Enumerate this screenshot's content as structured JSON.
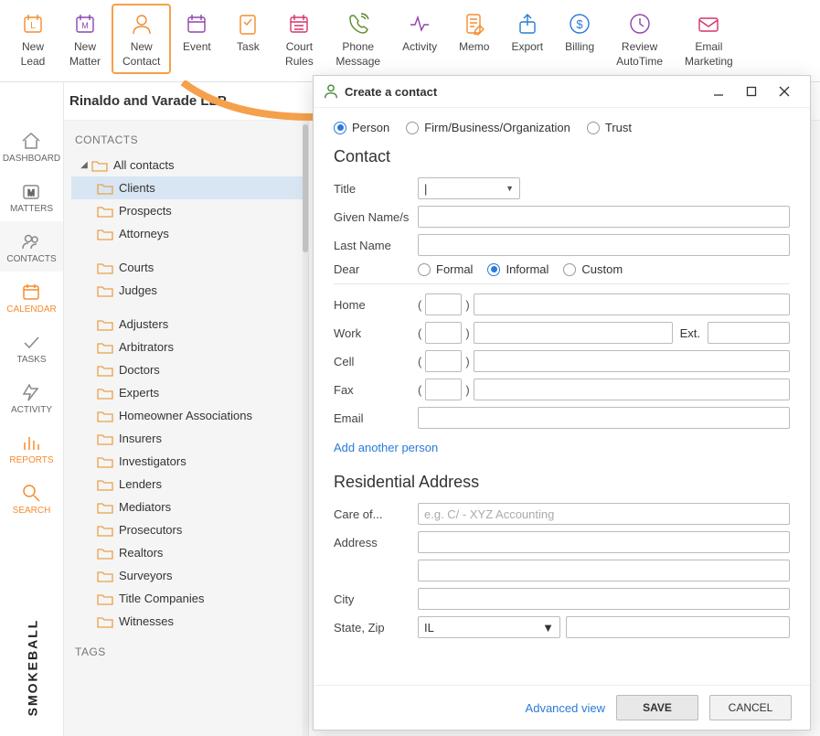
{
  "ribbon": [
    {
      "label1": "New",
      "label2": "Lead",
      "color": "#f58b2e",
      "name": "new-lead-button"
    },
    {
      "label1": "New",
      "label2": "Matter",
      "color": "#8e44ad",
      "name": "new-matter-button"
    },
    {
      "label1": "New",
      "label2": "Contact",
      "color": "#f58b2e",
      "name": "new-contact-button",
      "highlight": true
    },
    {
      "label1": "Event",
      "label2": "",
      "color": "#8e44ad",
      "name": "event-button"
    },
    {
      "label1": "Task",
      "label2": "",
      "color": "#f58b2e",
      "name": "task-button"
    },
    {
      "label1": "Court",
      "label2": "Rules",
      "color": "#d6336c",
      "name": "court-rules-button"
    },
    {
      "label1": "Phone",
      "label2": "Message",
      "color": "#5b8a2c",
      "name": "phone-message-button"
    },
    {
      "label1": "Activity",
      "label2": "",
      "color": "#8e44ad",
      "name": "activity-button"
    },
    {
      "label1": "Memo",
      "label2": "",
      "color": "#f58b2e",
      "name": "memo-button"
    },
    {
      "label1": "Export",
      "label2": "",
      "color": "#2a7ad6",
      "name": "export-button"
    },
    {
      "label1": "Billing",
      "label2": "",
      "color": "#2a7ad6",
      "name": "billing-button"
    },
    {
      "label1": "Review",
      "label2": "AutoTime",
      "color": "#8e44ad",
      "name": "review-autotime-button"
    },
    {
      "label1": "Email",
      "label2": "Marketing",
      "color": "#d6336c",
      "name": "email-marketing-button"
    }
  ],
  "firm": {
    "name": "Rinaldo and Varade LLP"
  },
  "leftnav": [
    {
      "label": "DASHBOARD",
      "name": "nav-dashboard"
    },
    {
      "label": "MATTERS",
      "name": "nav-matters"
    },
    {
      "label": "CONTACTS",
      "name": "nav-contacts",
      "selected": true
    },
    {
      "label": "CALENDAR",
      "name": "nav-calendar",
      "active": true
    },
    {
      "label": "TASKS",
      "name": "nav-tasks"
    },
    {
      "label": "ACTIVITY",
      "name": "nav-activity"
    },
    {
      "label": "REPORTS",
      "name": "nav-reports",
      "active": true
    },
    {
      "label": "SEARCH",
      "name": "nav-search",
      "active": true
    }
  ],
  "smokeball": "SMOKEBALL",
  "sidebar": {
    "heading": "CONTACTS",
    "root": "All contacts",
    "groups": [
      [
        "Clients",
        "Prospects",
        "Attorneys"
      ],
      [
        "Courts",
        "Judges"
      ],
      [
        "Adjusters",
        "Arbitrators",
        "Doctors",
        "Experts",
        "Homeowner Associations",
        "Insurers",
        "Investigators",
        "Lenders",
        "Mediators",
        "Prosecutors",
        "Realtors",
        "Surveyors",
        "Title Companies",
        "Witnesses"
      ]
    ],
    "selected": "Clients",
    "tags": "TAGS"
  },
  "dialog": {
    "title": "Create a contact",
    "types": [
      "Person",
      "Firm/Business/Organization",
      "Trust"
    ],
    "type_selected": "Person",
    "section_contact": "Contact",
    "labels": {
      "title": "Title",
      "given": "Given Name/s",
      "last": "Last Name",
      "dear": "Dear",
      "home": "Home",
      "work": "Work",
      "cell": "Cell",
      "fax": "Fax",
      "email": "Email",
      "ext": "Ext.",
      "add_person": "Add another person",
      "res_addr": "Residential Address",
      "careof": "Care of...",
      "careof_ph": "e.g. C/ - XYZ Accounting",
      "address": "Address",
      "city": "City",
      "statezip": "State, Zip",
      "state_val": "IL",
      "advanced": "Advanced view",
      "save": "SAVE",
      "cancel": "CANCEL"
    },
    "dear_opts": [
      "Formal",
      "Informal",
      "Custom"
    ],
    "dear_selected": "Informal"
  }
}
